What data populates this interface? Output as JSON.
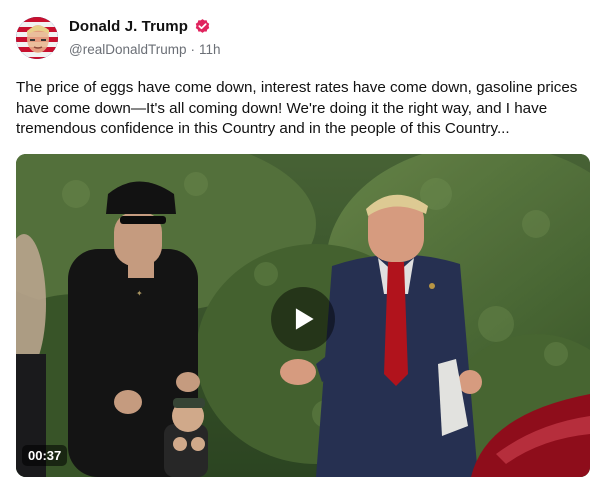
{
  "author": {
    "display_name": "Donald J. Trump",
    "handle": "@realDonaldTrump",
    "timestamp": "11h",
    "separator": "·",
    "verified_icon": "verified-badge-icon",
    "verified_color": "#e0245e"
  },
  "post": {
    "text": "The price of eggs have come down, interest rates have come down, gasoline prices have come down—It's all coming down! We're doing it the right way, and I have tremendous confidence in this Country and in the people of this Country..."
  },
  "video": {
    "duration": "00:37",
    "play_icon": "play-icon"
  }
}
